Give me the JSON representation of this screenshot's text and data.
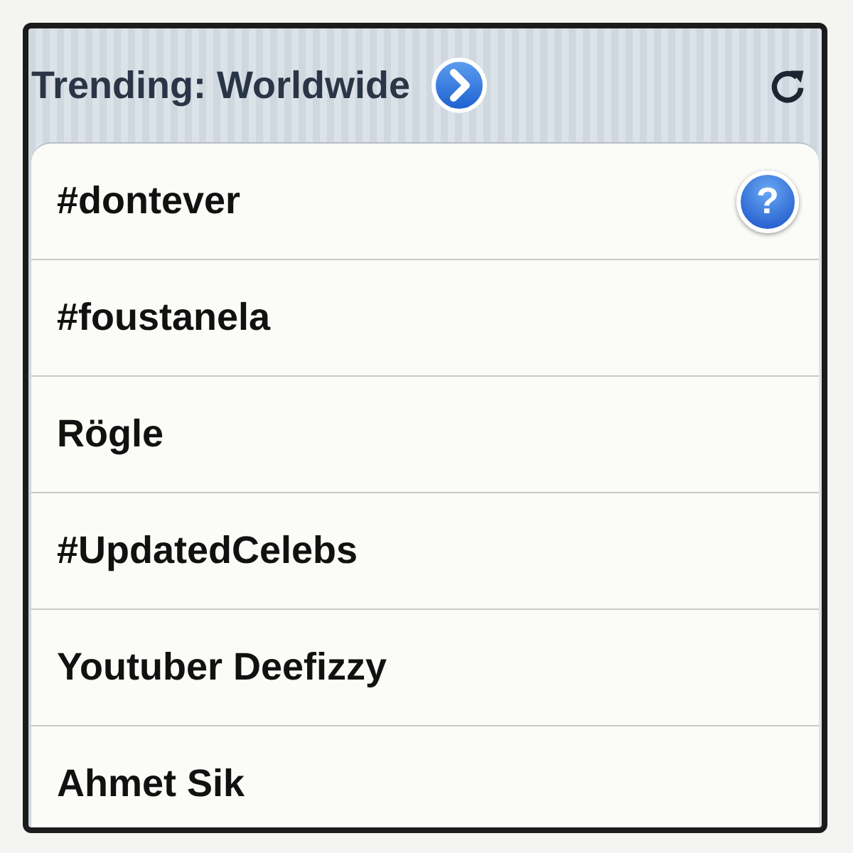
{
  "header": {
    "title": "Trending: Worldwide"
  },
  "trends": [
    {
      "label": "#dontever",
      "badge": "?"
    },
    {
      "label": "#foustanela"
    },
    {
      "label": "Rögle"
    },
    {
      "label": "#UpdatedCelebs"
    },
    {
      "label": "Youtuber Deefizzy"
    },
    {
      "label": "Ahmet Sik"
    }
  ]
}
